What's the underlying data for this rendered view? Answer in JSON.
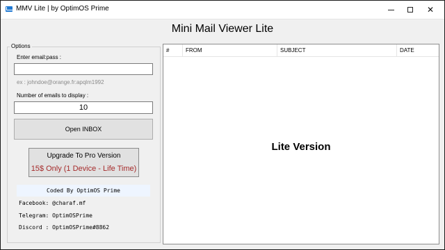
{
  "window": {
    "title": "MMV Lite | by OptimOS Prime",
    "icon": "mail-icon"
  },
  "main_title": "Mini Mail Viewer Lite",
  "options": {
    "legend": "Options",
    "email_label": "Enter email:pass :",
    "email_value": "",
    "email_hint": "ex : johndoe@orange.fr:apqlm1992",
    "count_label": "Number of emails to display :",
    "count_value": "10",
    "open_inbox_label": "Open INBOX",
    "upgrade_line1": "Upgrade To Pro Version",
    "upgrade_line2": "15$ Only (1 Device - Life Time)",
    "coded_by": "Coded By OptimOS Prime",
    "facebook": "Facebook: @charaf.mf",
    "telegram": "Telegram: OptimOSPrime",
    "discord": "Discord : OptimOSPrime#8862"
  },
  "list": {
    "columns": [
      "#",
      "FROM",
      "SUBJECT",
      "DATE"
    ],
    "overlay_text": "Lite Version"
  },
  "colors": {
    "upgrade_price": "#a52a2a",
    "coded_by_bg": "#eef5ff",
    "window_bg": "#f0f0f0"
  }
}
